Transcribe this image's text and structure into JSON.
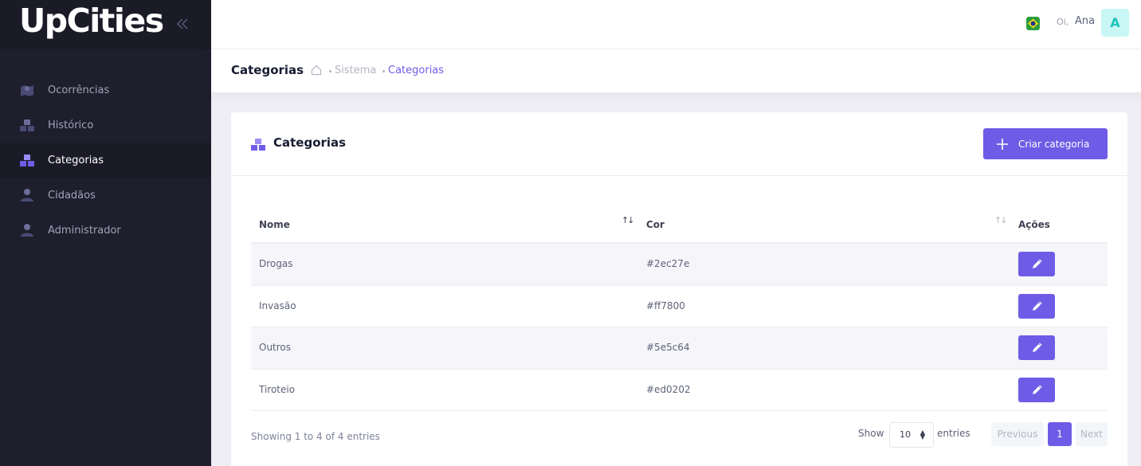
{
  "brand": {
    "logo": "UpCities"
  },
  "sidebar": {
    "items": [
      {
        "label": "Ocorrências",
        "icon": "map-marker-icon",
        "active": false
      },
      {
        "label": "Histórico",
        "icon": "boxes-icon",
        "active": false
      },
      {
        "label": "Categorias",
        "icon": "boxes-icon",
        "active": true
      },
      {
        "label": "Cidadãos",
        "icon": "user-icon",
        "active": false
      },
      {
        "label": "Administrador",
        "icon": "user-icon",
        "active": false
      }
    ]
  },
  "header": {
    "greeting": "Oi,",
    "user_name": "Ana",
    "avatar_letter": "A",
    "flag": "brazil-flag-icon"
  },
  "subheader": {
    "title": "Categorias",
    "breadcrumb": [
      "Sistema",
      "Categorias"
    ]
  },
  "card": {
    "title": "Categorias",
    "create_button": "Criar categoria"
  },
  "table": {
    "columns": [
      "Nome",
      "Cor",
      "Ações"
    ],
    "rows": [
      {
        "nome": "Drogas",
        "cor": "#2ec27e"
      },
      {
        "nome": "Invasão",
        "cor": "#ff7800"
      },
      {
        "nome": "Outros",
        "cor": "#5e5c64"
      },
      {
        "nome": "Tiroteio",
        "cor": "#ed0202"
      }
    ]
  },
  "footer": {
    "info": "Showing 1 to 4 of 4 entries",
    "show_label": "Show",
    "page_length": "10",
    "entries_label": "entries",
    "prev": "Previous",
    "page": "1",
    "next": "Next"
  },
  "colors": {
    "accent": "#6f5ce6",
    "sidebar": "#1e1e2d"
  }
}
